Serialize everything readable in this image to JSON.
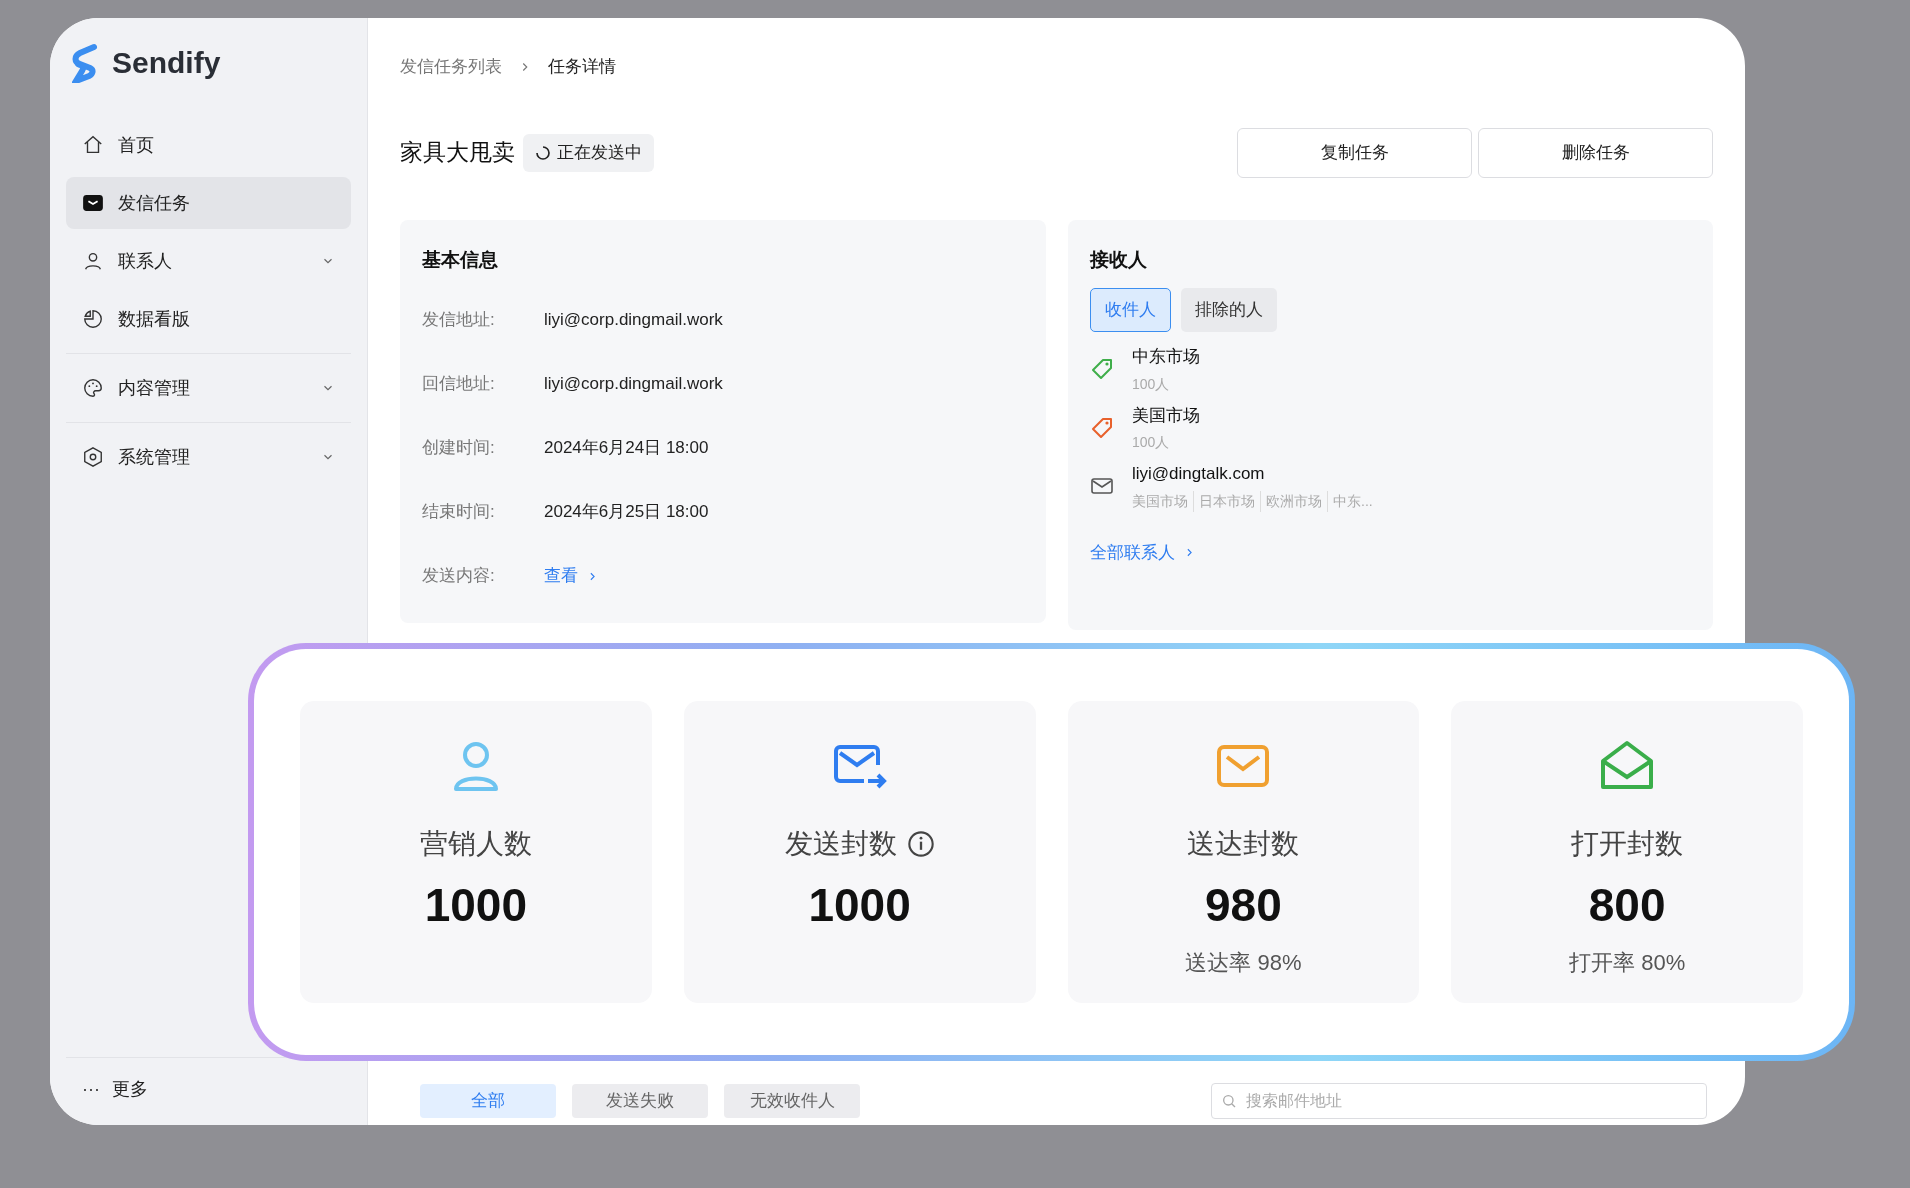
{
  "sidebar": {
    "brand": "Sendify",
    "sections": [
      [
        {
          "label": "首页",
          "kind": "link",
          "selected": false
        },
        {
          "label": "发信任务",
          "kind": "link",
          "selected": true
        },
        {
          "label": "联系人",
          "kind": "group",
          "selected": false,
          "expanded": false
        },
        {
          "label": "数据看版",
          "kind": "link",
          "selected": false
        }
      ],
      [
        {
          "label": "内容管理",
          "kind": "group",
          "selected": false,
          "expanded": false
        }
      ],
      [
        {
          "label": "系统管理",
          "kind": "group",
          "selected": false,
          "expanded": false
        }
      ]
    ],
    "more": {
      "icon": "···",
      "label": "更多"
    }
  },
  "breadcrumb": [
    "发信任务列表",
    "任务详情"
  ],
  "task": {
    "title": "家具大甩卖",
    "status": {
      "kind": "sending",
      "label": "正在发送中"
    },
    "buttons": [
      "复制任务",
      "删除任务"
    ]
  },
  "basic_info": {
    "title": "基本信息",
    "fields": [
      {
        "label": "发信地址:",
        "value": "liyi@corp.dingmail.work"
      },
      {
        "label": "回信地址:",
        "value": "liyi@corp.dingmail.work"
      },
      {
        "label": "创建时间:",
        "value": "2024年6月24日 18:00"
      },
      {
        "label": "结束时间:",
        "value": "2024年6月25日 18:00"
      },
      {
        "label": "发送内容:",
        "value": "查看",
        "kind": "link"
      }
    ]
  },
  "receivers": {
    "title": "接收人",
    "tabs": [
      {
        "label": "收件人",
        "selected": true
      },
      {
        "label": "排除的人",
        "selected": false
      }
    ],
    "items": [
      {
        "kind": "tag",
        "name": "中东市场",
        "detail": "100人",
        "color": "#3fae4a"
      },
      {
        "kind": "tag",
        "name": "美国市场",
        "detail": "100人",
        "color": "#e8612c"
      },
      {
        "kind": "email",
        "name": "liyi@dingtalk.com",
        "groups": [
          "美国市场",
          "日本市场",
          "欧洲市场",
          "中东..."
        ]
      }
    ],
    "link": "全部联系人"
  },
  "stats": [
    {
      "label": "营销人数",
      "value": "1000",
      "info": false
    },
    {
      "label": "发送封数",
      "value": "1000",
      "info": true
    },
    {
      "label": "送达封数",
      "value": "980",
      "sub": "送达率 98%",
      "info": false
    },
    {
      "label": "打开封数",
      "value": "800",
      "sub": "打开率 80%",
      "info": false
    }
  ],
  "records": {
    "tabs": [
      {
        "label": "全部",
        "selected": true
      },
      {
        "label": "发送失败",
        "selected": false
      },
      {
        "label": "无效收件人",
        "selected": false
      }
    ],
    "search": {
      "placeholder": "搜索邮件地址"
    }
  }
}
